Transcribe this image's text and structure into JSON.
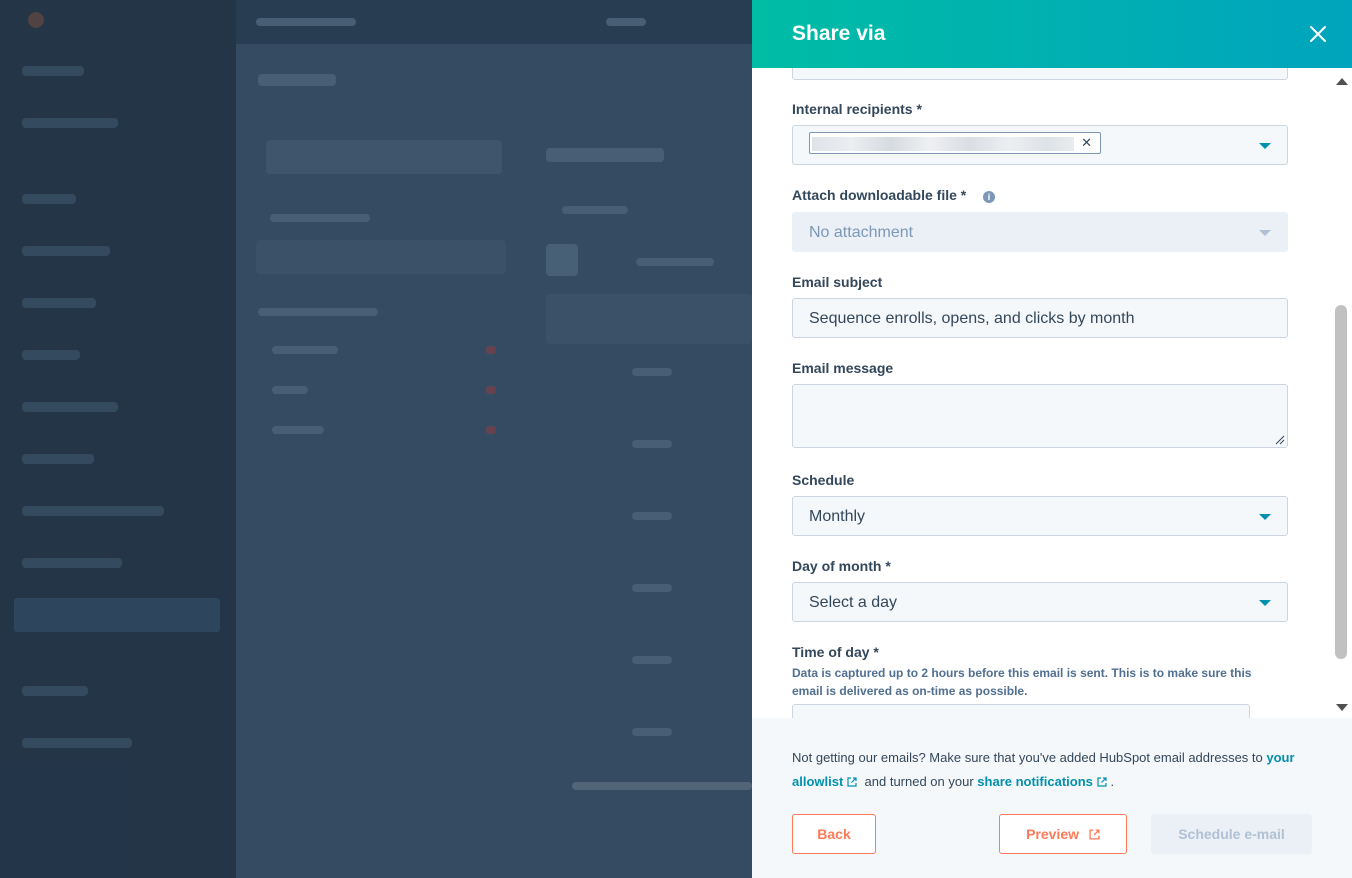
{
  "panel": {
    "title": "Share via",
    "close_icon": "close-icon"
  },
  "form": {
    "internal_recipients_label": "Internal recipients *",
    "attach_label": "Attach downloadable file *",
    "attach_value": "No attachment",
    "email_subject_label": "Email subject",
    "email_subject_value": "Sequence enrolls, opens, and clicks by month",
    "email_message_label": "Email message",
    "email_message_value": "",
    "schedule_label": "Schedule",
    "schedule_value": "Monthly",
    "day_of_month_label": "Day of month *",
    "day_of_month_value": "Select a day",
    "time_of_day_label": "Time of day *",
    "time_of_day_help": "Data is captured up to 2 hours before this email is sent. This is to make sure this email is delivered as on-time as possible."
  },
  "footer": {
    "notice_prefix": "Not getting our emails? Make sure that you've added HubSpot email addresses to",
    "allowlist_link": "your allowlist",
    "notice_middle": "and turned on your",
    "share_notifications_link": "share notifications",
    "notice_suffix": ".",
    "back_label": "Back",
    "preview_label": "Preview",
    "schedule_label": "Schedule e-mail"
  },
  "colors": {
    "header_start": "#00bda5",
    "header_end": "#00a4bd",
    "accent_orange": "#ff7a59",
    "link_teal": "#0091ae"
  }
}
